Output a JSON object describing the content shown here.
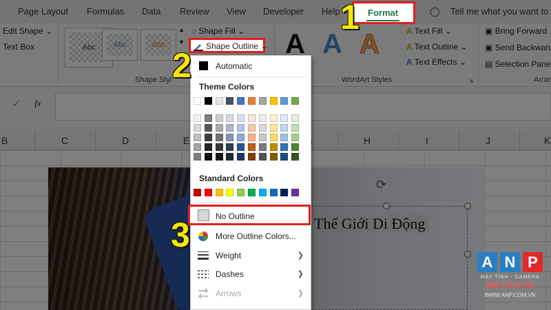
{
  "ribbon_tabs": [
    "Page Layout",
    "Formulas",
    "Data",
    "Review",
    "View",
    "Developer",
    "Help",
    "Format"
  ],
  "tell_me": "Tell me what you want to",
  "ribbon": {
    "edit_shape": "Edit Shape",
    "text_box": "Text Box",
    "shape_styles_label": "Shape Styl",
    "style_thumb_text": "Abc",
    "shape_fill": "Shape Fill",
    "shape_outline": "Shape Outline",
    "wordart_letter": "A",
    "text_fill": "Text Fill",
    "text_outline": "Text Outline",
    "text_effects": "Text Effects",
    "wordart_label": "WordArt Styles",
    "bring_forward": "Bring Forward",
    "send_backward": "Send Backward",
    "selection_pane": "Selection Pane",
    "arrange_label": "Arrar"
  },
  "formula_bar": {
    "fx": "fx",
    "check": "✓"
  },
  "columns": [
    "B",
    "C",
    "D",
    "E",
    "G",
    "H",
    "I",
    "J",
    "K"
  ],
  "steps": [
    "1",
    "2",
    "3"
  ],
  "menu": {
    "automatic": "Automatic",
    "theme_colors_header": "Theme Colors",
    "standard_colors_header": "Standard Colors",
    "no_outline": "No Outline",
    "more_colors": "More Outline Colors...",
    "weight": "Weight",
    "dashes": "Dashes",
    "arrows": "Arrows"
  },
  "theme_top_row": [
    "#ffffff",
    "#000000",
    "#e7e6e6",
    "#44546a",
    "#4472c4",
    "#ed7d31",
    "#a5a5a5",
    "#ffc000",
    "#5b9bd5",
    "#70ad47"
  ],
  "theme_shades": [
    [
      "#f2f2f2",
      "#808080",
      "#d0cece",
      "#d6dce4",
      "#d9e2f3",
      "#fbe5d5",
      "#ededed",
      "#fff2cc",
      "#deeaf6",
      "#e2efd9"
    ],
    [
      "#d9d9d9",
      "#595959",
      "#aeabab",
      "#adb9ca",
      "#b4c6e7",
      "#f7caac",
      "#dbdbdb",
      "#fee599",
      "#bdd7ee",
      "#c5e0b3"
    ],
    [
      "#bfbfbf",
      "#404040",
      "#757070",
      "#8496b0",
      "#8eaadb",
      "#f4b183",
      "#c9c9c9",
      "#ffd966",
      "#9cc3e5",
      "#a8d08d"
    ],
    [
      "#a6a6a6",
      "#262626",
      "#3a3838",
      "#323f4f",
      "#2f5496",
      "#c55a11",
      "#7b7b7b",
      "#bf8f00",
      "#2e75b5",
      "#538135"
    ],
    [
      "#7f7f7f",
      "#0d0d0d",
      "#171616",
      "#222a35",
      "#1f3864",
      "#833c0b",
      "#525252",
      "#7f6000",
      "#1e4e79",
      "#375623"
    ]
  ],
  "standard_colors": [
    "#c00000",
    "#ff0000",
    "#ffc000",
    "#ffff00",
    "#92d050",
    "#00b050",
    "#00b0f0",
    "#0070c0",
    "#002060",
    "#7030a0"
  ],
  "shape_text": "Thế Giới Di Động",
  "logo": {
    "letters": [
      "A",
      "N",
      "P"
    ],
    "tagline": "MÁY TÍNH - CAMERA",
    "phone": "098 772 0 772",
    "site": "WWW.ANP.COM.VN"
  },
  "colors": {
    "highlight": "#e01e1e",
    "step_number": "#f5e60a",
    "excel_green": "#217346",
    "logo_blue": "#2a7fc4",
    "logo_red": "#e02a2a"
  }
}
